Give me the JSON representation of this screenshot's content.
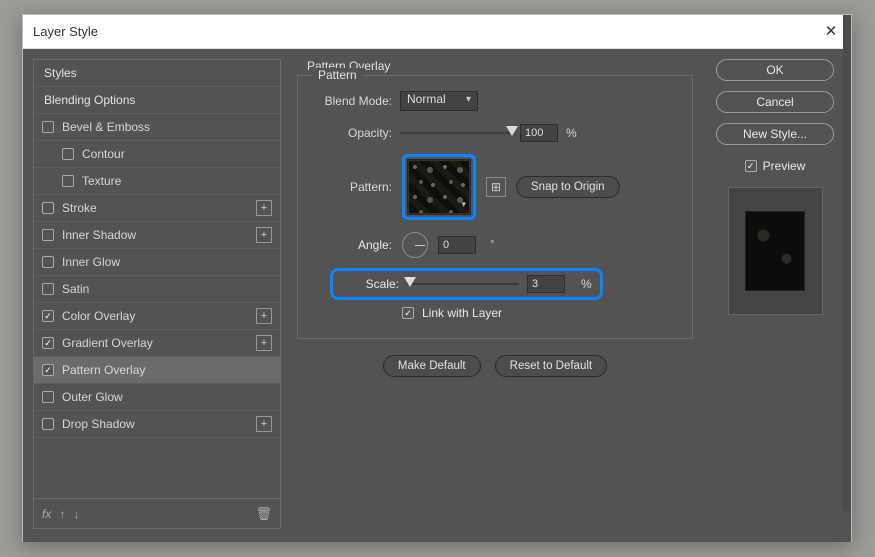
{
  "window": {
    "title": "Layer Style"
  },
  "left": {
    "styles_header": "Styles",
    "blending_header": "Blending Options",
    "items": {
      "bevel": "Bevel & Emboss",
      "contour": "Contour",
      "texture": "Texture",
      "stroke": "Stroke",
      "innerShadow": "Inner Shadow",
      "innerGlow": "Inner Glow",
      "satin": "Satin",
      "colorOverlay": "Color Overlay",
      "gradientOverlay": "Gradient Overlay",
      "patternOverlay": "Pattern Overlay",
      "outerGlow": "Outer Glow",
      "dropShadow": "Drop Shadow"
    },
    "footer": {
      "fx": "fx"
    }
  },
  "panel": {
    "title": "Pattern Overlay",
    "group": "Pattern",
    "blendMode": {
      "label": "Blend Mode:",
      "value": "Normal"
    },
    "opacity": {
      "label": "Opacity:",
      "value": "100",
      "unit": "%"
    },
    "pattern": {
      "label": "Pattern:",
      "newIcon": "⊞",
      "snap": "Snap to Origin"
    },
    "angle": {
      "label": "Angle:",
      "value": "0",
      "unit": "°"
    },
    "scale": {
      "label": "Scale:",
      "value": "3",
      "unit": "%"
    },
    "link": {
      "label": "Link with Layer"
    },
    "makeDefault": "Make Default",
    "resetDefault": "Reset to Default"
  },
  "right": {
    "ok": "OK",
    "cancel": "Cancel",
    "newStyle": "New Style...",
    "preview": "Preview"
  }
}
